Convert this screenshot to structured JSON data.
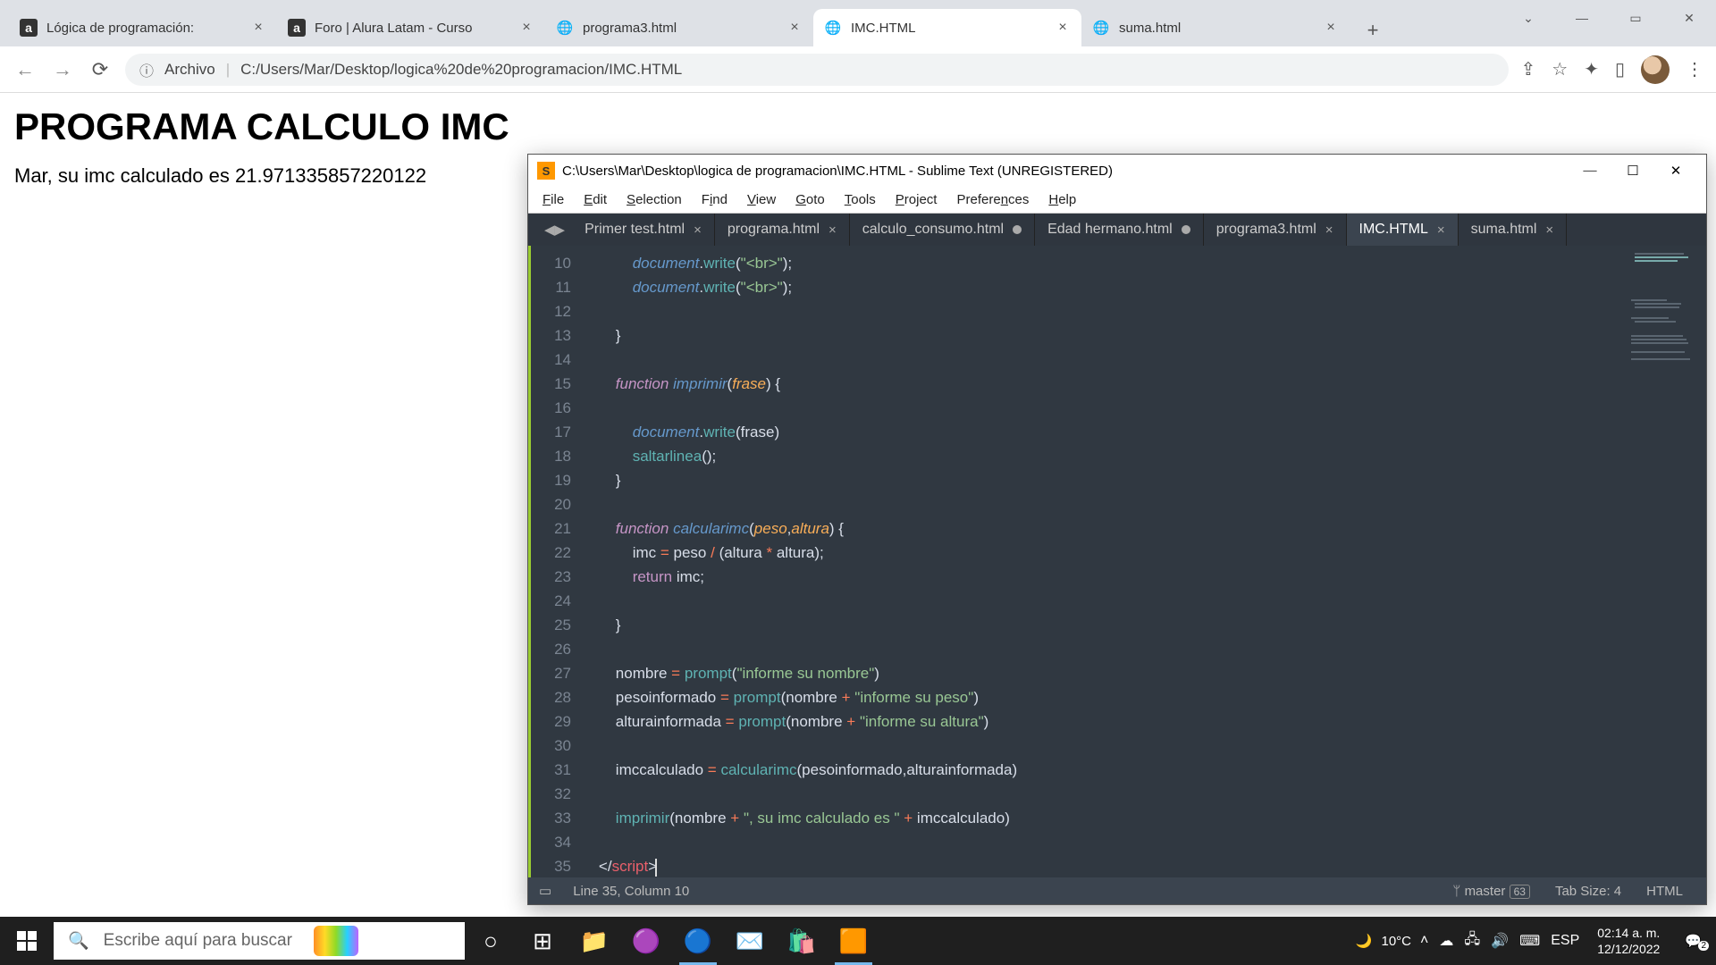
{
  "chrome": {
    "tabs": [
      {
        "title": "Lógica de programación:",
        "favicon": "alura",
        "active": false
      },
      {
        "title": "Foro | Alura Latam - Curso",
        "favicon": "alura",
        "active": false
      },
      {
        "title": "programa3.html",
        "favicon": "globe",
        "active": false
      },
      {
        "title": "IMC.HTML",
        "favicon": "globe",
        "active": true
      },
      {
        "title": "suma.html",
        "favicon": "globe",
        "active": false
      }
    ],
    "addr_label": "Archivo",
    "addr_path": "C:/Users/Mar/Desktop/logica%20de%20programacion/IMC.HTML"
  },
  "page": {
    "heading": "PROGRAMA CALCULO IMC",
    "body_text": "Mar, su imc calculado es 21.971335857220122"
  },
  "sublime": {
    "title": "C:\\Users\\Mar\\Desktop\\logica de programacion\\IMC.HTML - Sublime Text (UNREGISTERED)",
    "menu": [
      "File",
      "Edit",
      "Selection",
      "Find",
      "View",
      "Goto",
      "Tools",
      "Project",
      "Preferences",
      "Help"
    ],
    "menu_underline": [
      "F",
      "E",
      "S",
      "i",
      "V",
      "G",
      "T",
      "j",
      "n",
      "H"
    ],
    "tabs": [
      {
        "name": "Primer test.html",
        "dirty": false,
        "close": true
      },
      {
        "name": "programa.html",
        "dirty": false,
        "close": true
      },
      {
        "name": "calculo_consumo.html",
        "dirty": true,
        "close": false
      },
      {
        "name": "Edad hermano.html",
        "dirty": true,
        "close": false
      },
      {
        "name": "programa3.html",
        "dirty": false,
        "close": true
      },
      {
        "name": "IMC.HTML",
        "dirty": false,
        "close": true,
        "active": true
      },
      {
        "name": "suma.html",
        "dirty": false,
        "close": true
      }
    ],
    "first_line": 10,
    "last_line": 35,
    "status": {
      "cursor": "Line 35, Column 10",
      "branch": "master",
      "branch_count": "63",
      "tab_size": "Tab Size: 4",
      "syntax": "HTML"
    }
  },
  "taskbar": {
    "search_placeholder": "Escribe aquí para buscar",
    "temp": "10°C",
    "lang": "ESP",
    "time": "02:14 a. m.",
    "date": "12/12/2022",
    "notif_count": "2"
  }
}
